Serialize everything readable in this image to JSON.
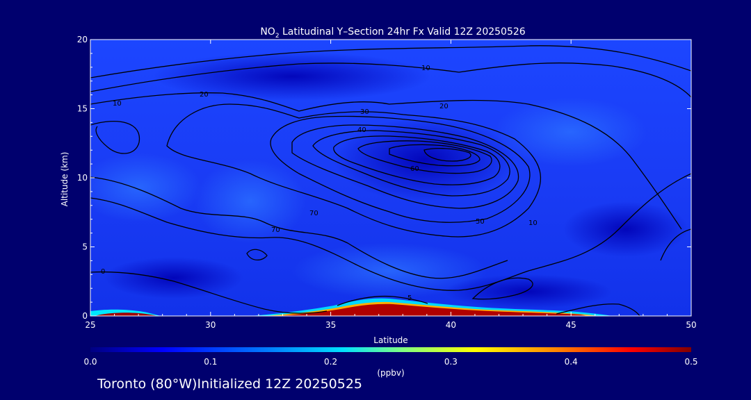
{
  "chart_data": {
    "type": "heatmap",
    "title_prefix": "NO",
    "title_subscript": "2",
    "title_suffix": " Latitudinal Y–Section 24hr  Fx Valid 12Z 20250526",
    "xlabel": "Latitude",
    "ylabel": "Altitude (km)",
    "xlim": [
      25,
      50
    ],
    "ylim": [
      0,
      20
    ],
    "x_ticks": [
      25,
      30,
      35,
      40,
      45,
      50
    ],
    "y_ticks": [
      0,
      5,
      10,
      15,
      20
    ],
    "colorbar": {
      "label": "(ppbv)",
      "range": [
        0.0,
        0.5
      ],
      "ticks": [
        "0.0",
        "0.1",
        "0.2",
        "0.3",
        "0.4",
        "0.5"
      ],
      "colors": [
        "#000080",
        "#0000ff",
        "#0080ff",
        "#00ffff",
        "#80ff80",
        "#ffff00",
        "#ff8000",
        "#ff0000",
        "#800000"
      ]
    },
    "surface_no2": [
      {
        "lat": 25.0,
        "alt_km": 0.5,
        "ppbv": 0.05
      },
      {
        "lat": 26.5,
        "alt_km": 0.0,
        "ppbv": 0.5
      },
      {
        "lat": 29.0,
        "alt_km": 0.0,
        "ppbv": 0.1
      },
      {
        "lat": 33.0,
        "alt_km": 0.0,
        "ppbv": 0.2
      },
      {
        "lat": 37.5,
        "alt_km": 0.0,
        "ppbv": 0.5
      },
      {
        "lat": 43.0,
        "alt_km": 0.0,
        "ppbv": 0.45
      },
      {
        "lat": 47.0,
        "alt_km": 0.0,
        "ppbv": 0.1
      }
    ],
    "contour_labels": [
      "10",
      "20",
      "30",
      "40",
      "50",
      "60",
      "70",
      "0",
      "5"
    ],
    "grid": false
  },
  "footer": {
    "text": "Toronto (80°W)Initialized 12Z 20250525"
  }
}
